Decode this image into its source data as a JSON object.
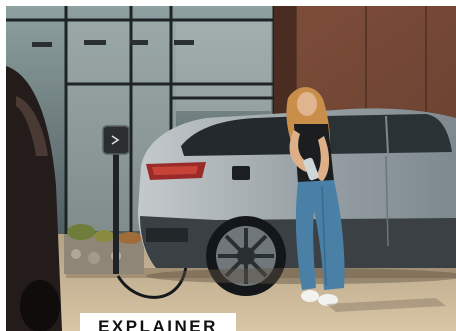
{
  "badge": {
    "label": "EXPLAINER"
  },
  "colors": {
    "wall_panel": "#7a4a36",
    "glass": "#6f7f80",
    "car_body": "#a9b0b3",
    "denim": "#4a7fa6",
    "hair": "#c98f4a",
    "pavement": "#c9b79a"
  }
}
